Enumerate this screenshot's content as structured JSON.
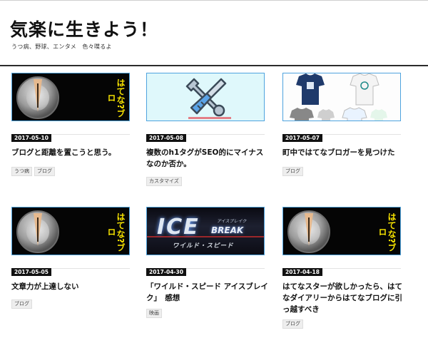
{
  "site": {
    "title": "気楽に生きよう！",
    "description": "うつ病、野球、エンタメ　色々喋るよ"
  },
  "posts": [
    {
      "date": "2017-05-10",
      "title": "ブログと距離を置こうと思う。",
      "tags": [
        "うつ病",
        "ブログ"
      ],
      "thumb": "pen-icon",
      "thumb_text": "はてな?ブロ"
    },
    {
      "date": "2017-05-08",
      "title": "複数のh1タグがSEO的にマイナスなのか否か。",
      "tags": [
        "カスタマイズ"
      ],
      "thumb": "tools-icon"
    },
    {
      "date": "2017-05-07",
      "title": "町中ではてなブロガーを見つけた",
      "tags": [
        "ブログ"
      ],
      "thumb": "tshirts-image"
    },
    {
      "date": "2017-05-05",
      "title": "文章力が上達しない",
      "tags": [
        "ブログ"
      ],
      "thumb": "pen-icon",
      "thumb_text": "はてな?ブロ"
    },
    {
      "date": "2017-04-30",
      "title": "「ワイルド・スピード アイスブレイク」　感想",
      "tags": [
        "映画"
      ],
      "thumb": "movie-poster",
      "poster": {
        "title": "ICE",
        "subtitle": "BREAK",
        "small": "アイスブレイク",
        "tagline": "ワイルド・スピード"
      }
    },
    {
      "date": "2017-04-18",
      "title": "はてなスターが欲しかったら、はてなダイアリーからはてなブログに引っ越すべき",
      "tags": [
        "ブログ"
      ],
      "thumb": "pen-icon",
      "thumb_text": "はてな?ブロ"
    }
  ],
  "colors": {
    "accent_border": "#4ea3de",
    "date_badge": "#111111",
    "pen_text": "#f6e200"
  }
}
